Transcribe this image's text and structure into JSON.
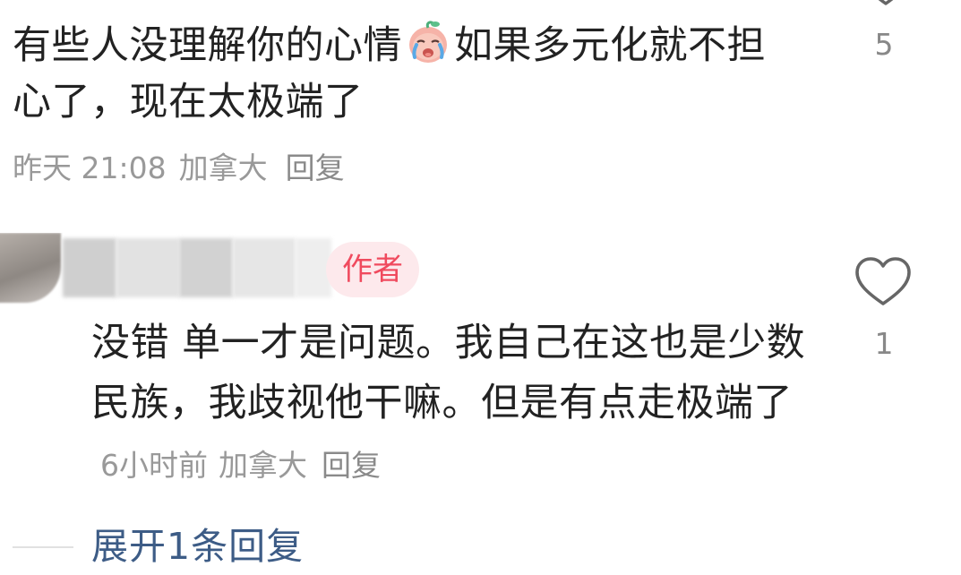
{
  "comments": [
    {
      "text_before_emoji": "有些人没理解你的心情",
      "emoji": "crying-face",
      "text_after_emoji": "如果多元化就不担心了，现在太极端了",
      "time": "昨天 21:08",
      "location": "加拿大",
      "reply_label": "回复",
      "like_count": "5"
    },
    {
      "author_badge": "作者",
      "text": "没错 单一才是问题。我自己在这也是少数民族，我歧视他干嘛。但是有点走极端了",
      "time": "6小时前",
      "location": "加拿大",
      "reply_label": "回复",
      "like_count": "1"
    }
  ],
  "expand_replies_label": "展开1条回复",
  "colors": {
    "text": "#222222",
    "meta": "#999999",
    "author_badge_bg": "#fde9ec",
    "author_badge_text": "#f04a5e",
    "expand_link": "#3d5c86",
    "icon": "#666666"
  },
  "icons": {
    "like": "heart-outline-icon",
    "emoji": "crying-face-icon"
  }
}
